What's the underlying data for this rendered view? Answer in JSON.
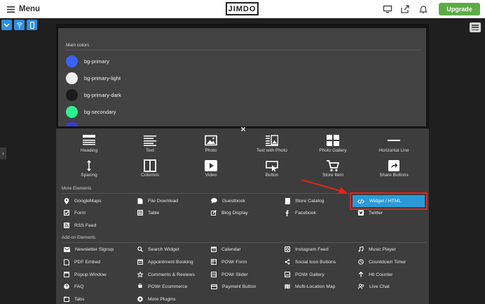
{
  "topbar": {
    "menu_label": "Menu",
    "logo": "JIMDO",
    "upgrade_label": "Upgrade",
    "icons": [
      "desktop-icon",
      "share-icon",
      "bell-icon"
    ]
  },
  "device_icons": [
    "chevron-down-icon",
    "tablet-icon",
    "phone-icon"
  ],
  "colors_panel": {
    "title": "Main colors",
    "items": [
      {
        "label": "bg-primary",
        "color": "#3a63f0"
      },
      {
        "label": "bg-primary-light",
        "color": "#f0f0f0"
      },
      {
        "label": "bg-primary-dark",
        "color": "#1b1b1b"
      },
      {
        "label": "bg-secondary",
        "color": "#2ef08e"
      }
    ],
    "partial_swatch_color": "#3a3ad0"
  },
  "basic_elements": [
    {
      "label": "Heading",
      "icon": "heading-icon"
    },
    {
      "label": "Text",
      "icon": "text-icon"
    },
    {
      "label": "Photo",
      "icon": "photo-icon"
    },
    {
      "label": "Text with Photo",
      "icon": "text-with-photo-icon"
    },
    {
      "label": "Photo Gallery",
      "icon": "gallery-icon"
    },
    {
      "label": "Horizontal Line",
      "icon": "horizontal-line-icon"
    },
    {
      "label": "Spacing",
      "icon": "spacing-icon"
    },
    {
      "label": "Columns",
      "icon": "columns-icon"
    },
    {
      "label": "Video",
      "icon": "video-icon"
    },
    {
      "label": "Button",
      "icon": "button-icon"
    },
    {
      "label": "Store Item",
      "icon": "cart-icon"
    },
    {
      "label": "Share Buttons",
      "icon": "share-icon"
    }
  ],
  "more_elements": {
    "title": "More Elements",
    "items": [
      {
        "label": "GoogleMaps",
        "icon": "map-pin-icon"
      },
      {
        "label": "File Download",
        "icon": "download-icon"
      },
      {
        "label": "Guestbook",
        "icon": "chat-bubble-icon"
      },
      {
        "label": "Store Catalog",
        "icon": "catalog-icon"
      },
      {
        "label": "Widget / HTML",
        "icon": "code-icon"
      },
      {
        "label": "Form",
        "icon": "checkbox-icon"
      },
      {
        "label": "Table",
        "icon": "table-icon"
      },
      {
        "label": "Blog Display",
        "icon": "edit-icon"
      },
      {
        "label": "Facebook",
        "icon": "facebook-icon"
      },
      {
        "label": "Twitter",
        "icon": "twitter-icon"
      },
      {
        "label": "RSS Feed",
        "icon": "rss-icon"
      }
    ]
  },
  "addon_elements": {
    "title": "Add-on Elements",
    "items": [
      {
        "label": "Newsletter Signup",
        "icon": "mail-icon"
      },
      {
        "label": "Search Widget",
        "icon": "search-icon"
      },
      {
        "label": "Calendar",
        "icon": "calendar-icon"
      },
      {
        "label": "Instagram Feed",
        "icon": "instagram-icon"
      },
      {
        "label": "Music Player",
        "icon": "music-icon"
      },
      {
        "label": "PDF Embed",
        "icon": "pdf-icon"
      },
      {
        "label": "Appointment Booking",
        "icon": "appointment-icon"
      },
      {
        "label": "POWr Form",
        "icon": "powr-form-icon"
      },
      {
        "label": "Social Icon Buttons",
        "icon": "social-icon"
      },
      {
        "label": "Countdown Timer",
        "icon": "timer-icon"
      },
      {
        "label": "Popup Window",
        "icon": "popup-icon"
      },
      {
        "label": "Comments & Reviews",
        "icon": "star-icon"
      },
      {
        "label": "POWr Slider",
        "icon": "slider-icon"
      },
      {
        "label": "POWr Gallery",
        "icon": "powr-gallery-icon"
      },
      {
        "label": "Hit Counter",
        "icon": "hit-counter-icon"
      },
      {
        "label": "FAQ",
        "icon": "question-icon"
      },
      {
        "label": "POWr Ecommerce",
        "icon": "ecommerce-icon"
      },
      {
        "label": "Payment Button",
        "icon": "payment-icon"
      },
      {
        "label": "Multi-Location Map",
        "icon": "multi-map-icon"
      },
      {
        "label": "Live Chat",
        "icon": "live-chat-icon"
      },
      {
        "label": "Tabs",
        "icon": "tabs-icon"
      },
      {
        "label": "More Plugins",
        "icon": "plus-circle-icon"
      }
    ]
  },
  "highlight_color": "#e0241b",
  "accent_color": "#2a9bd6",
  "upgrade_color": "#5dab45"
}
